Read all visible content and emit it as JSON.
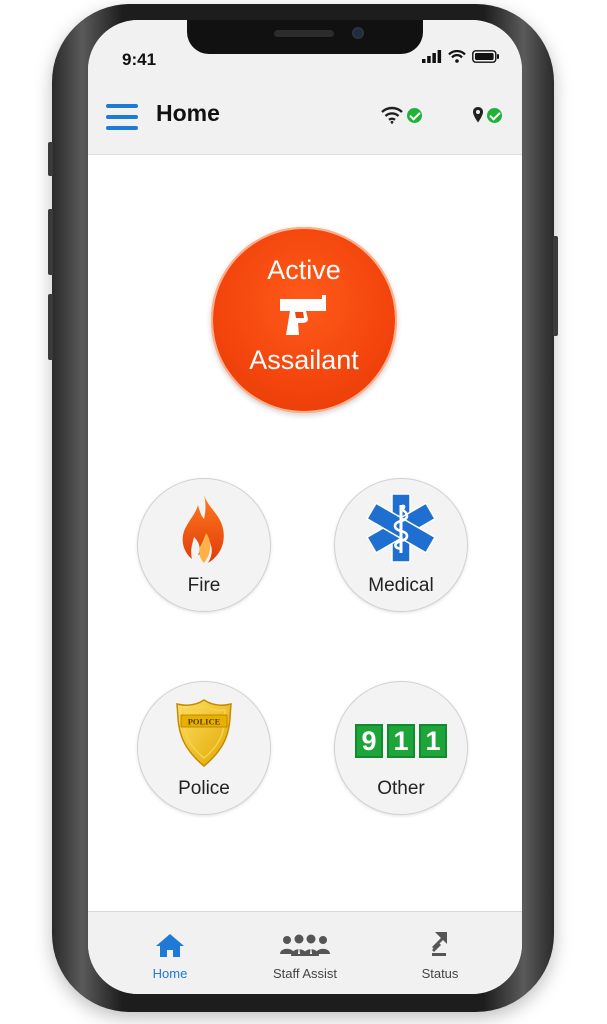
{
  "status_bar": {
    "time": "9:41"
  },
  "header": {
    "title": "Home",
    "wifi_status": "connected",
    "location_status": "enabled"
  },
  "primary_action": {
    "line1": "Active",
    "line2": "Assailant",
    "icon": "handgun-icon",
    "color": "#f2440c"
  },
  "actions": [
    {
      "label": "Fire",
      "icon": "flame-icon"
    },
    {
      "label": "Medical",
      "icon": "star-of-life-icon"
    },
    {
      "label": "Police",
      "icon": "police-badge-icon",
      "badge_text": "POLICE"
    },
    {
      "label": "Other",
      "icon": "nine-one-one-icon",
      "digits": [
        "9",
        "1",
        "1"
      ]
    }
  ],
  "tabs": [
    {
      "label": "Home",
      "icon": "home-icon",
      "active": true
    },
    {
      "label": "Staff Assist",
      "icon": "people-group-icon",
      "active": false
    },
    {
      "label": "Status",
      "icon": "status-arrows-icon",
      "active": false
    }
  ],
  "colors": {
    "accent": "#1f7ad6",
    "success": "#1fb33a",
    "medical": "#1f6fd1",
    "digits": "#1ea53a"
  }
}
